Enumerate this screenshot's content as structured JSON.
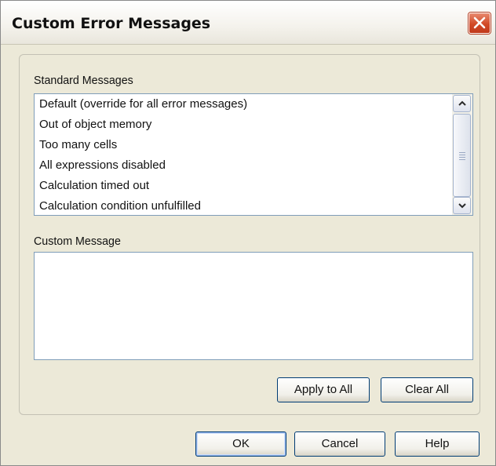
{
  "dialog": {
    "title": "Custom Error Messages"
  },
  "standard_messages": {
    "label": "Standard Messages",
    "items": [
      "Default (override for all error messages)",
      "Out of object memory",
      "Too many cells",
      "All expressions disabled",
      "Calculation timed out",
      "Calculation condition unfulfilled"
    ]
  },
  "custom_message": {
    "label": "Custom Message",
    "value": ""
  },
  "buttons": {
    "apply_to_all": "Apply to All",
    "clear_all": "Clear All",
    "ok": "OK",
    "cancel": "Cancel",
    "help": "Help"
  },
  "icons": {
    "close": "close-icon",
    "scroll_up": "arrow-up-icon",
    "scroll_down": "arrow-down-icon"
  },
  "colors": {
    "dialog_bg": "#ece9d8",
    "close_red": "#d24a27",
    "button_border": "#003c74"
  }
}
